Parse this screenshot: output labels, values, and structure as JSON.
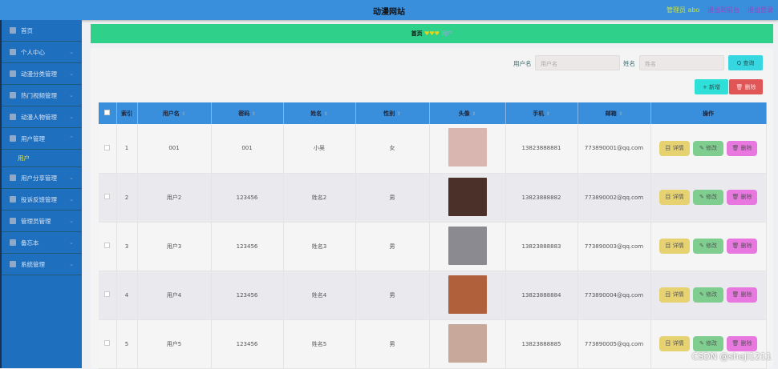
{
  "header": {
    "title": "动漫网站",
    "admin": "管理员 abo",
    "front": "退出到前台",
    "logout": "退出登录"
  },
  "sidebar": {
    "items": [
      {
        "label": "首页"
      },
      {
        "label": "个人中心"
      },
      {
        "label": "动漫分类管理"
      },
      {
        "label": "热门视频管理"
      },
      {
        "label": "动漫人物管理"
      },
      {
        "label": "用户管理"
      },
      {
        "label": "用户分享管理"
      },
      {
        "label": "投诉反馈管理"
      },
      {
        "label": "管理员管理"
      },
      {
        "label": "备忘本"
      },
      {
        "label": "系统管理"
      }
    ],
    "sub": "用户"
  },
  "breadcrumb": {
    "home": "首页",
    "sep": "♥♥♥",
    "current": "用户"
  },
  "search": {
    "username_label": "用户名",
    "username_placeholder": "用户名",
    "name_label": "姓名",
    "name_placeholder": "姓名",
    "query": "Q 查询"
  },
  "actions": {
    "add": "+ 新增",
    "delete": "🗑 删除"
  },
  "table": {
    "headers": [
      "索引",
      "用户名",
      "密码",
      "姓名",
      "性别",
      "头像",
      "手机",
      "邮箱",
      "操作"
    ],
    "ops": {
      "detail": "目 详情",
      "edit": "✎ 修改",
      "del": "🗑 删除"
    },
    "rows": [
      {
        "idx": "1",
        "user": "001",
        "pwd": "001",
        "name": "小吴",
        "sex": "女",
        "phone": "13823888881",
        "email": "773890001@qq.com",
        "avatar_color": "#d9b7b0"
      },
      {
        "idx": "2",
        "user": "用户2",
        "pwd": "123456",
        "name": "姓名2",
        "sex": "男",
        "phone": "13823888882",
        "email": "773890002@qq.com",
        "avatar_color": "#4a3028"
      },
      {
        "idx": "3",
        "user": "用户3",
        "pwd": "123456",
        "name": "姓名3",
        "sex": "男",
        "phone": "13823888883",
        "email": "773890003@qq.com",
        "avatar_color": "#8a8a90"
      },
      {
        "idx": "4",
        "user": "用户4",
        "pwd": "123456",
        "name": "姓名4",
        "sex": "男",
        "phone": "13823888884",
        "email": "773890004@qq.com",
        "avatar_color": "#b0603a"
      },
      {
        "idx": "5",
        "user": "用户5",
        "pwd": "123456",
        "name": "姓名5",
        "sex": "男",
        "phone": "13823888885",
        "email": "773890005@qq.com",
        "avatar_color": "#c8a89a"
      }
    ]
  },
  "watermark": "CSDN @sheji1211"
}
